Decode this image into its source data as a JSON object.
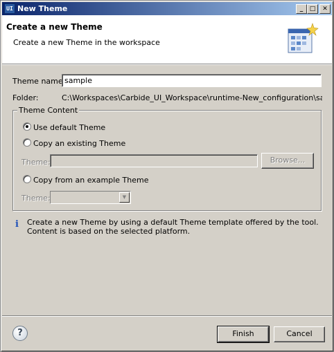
{
  "window": {
    "title": "New Theme",
    "app_icon_text": "UI",
    "minimize_icon": "minimize-icon",
    "maximize_icon": "maximize-icon",
    "close_icon": "close-icon"
  },
  "banner": {
    "title": "Create a new Theme",
    "description": "Create a new Theme in the workspace",
    "graphic": "theme-wizard-graphic"
  },
  "form": {
    "theme_name_label": "Theme name:",
    "theme_name_value": "sample",
    "folder_label": "Folder:",
    "folder_value": "C:\\Workspaces\\Carbide_UI_Workspace\\runtime-New_configuration\\sample"
  },
  "theme_content": {
    "group_title": "Theme Content",
    "options": [
      {
        "label": "Use default Theme",
        "checked": true
      },
      {
        "label": "Copy an existing Theme",
        "checked": false
      },
      {
        "label": "Copy from an example Theme",
        "checked": false
      }
    ],
    "existing_theme_label": "Theme:",
    "existing_theme_value": "",
    "browse_label": "Browse...",
    "example_theme_label": "Theme:",
    "example_theme_value": ""
  },
  "info": {
    "icon": "info-icon",
    "text": "Create a new Theme by using a default Theme template offered by the tool. Content is based on the selected platform."
  },
  "footer": {
    "help_icon": "help-icon",
    "finish_label": "Finish",
    "cancel_label": "Cancel"
  },
  "colors": {
    "titlebar_start": "#0a246a",
    "titlebar_end": "#a6caf0",
    "window_bg": "#d4d0c8",
    "info_icon": "#1d4fb8"
  }
}
